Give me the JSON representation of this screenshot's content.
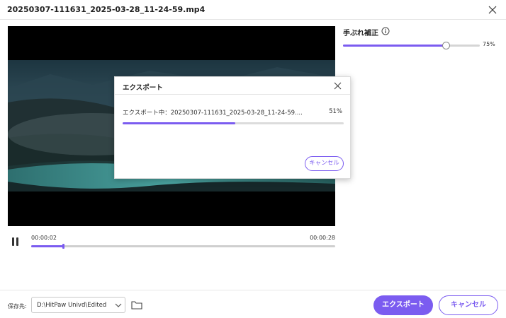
{
  "window": {
    "title": "20250307-111631_2025-03-28_11-24-59.mp4"
  },
  "player": {
    "current_time": "00:00:02",
    "duration": "00:00:28",
    "progress_fraction": 0.105
  },
  "stabilization": {
    "label": "手ぶれ補正",
    "value_text": "75%",
    "value_fraction": 0.75
  },
  "dialog": {
    "title": "エクスポート",
    "status_text": "エクスポート中：20250307-111631_2025-03-28_11-24-59....",
    "percent_text": "51%",
    "progress_fraction": 0.51,
    "cancel_label": "キャンセル"
  },
  "footer": {
    "save_label": "保存先:",
    "path_value": "D:\\HitPaw Univd\\Edited",
    "export_label": "エクスポート",
    "cancel_label": "キャンセル"
  },
  "colors": {
    "accent": "#7b5cf0"
  },
  "icons": [
    "close-icon",
    "info-icon",
    "pause-icon",
    "chevron-down-icon",
    "folder-icon"
  ]
}
